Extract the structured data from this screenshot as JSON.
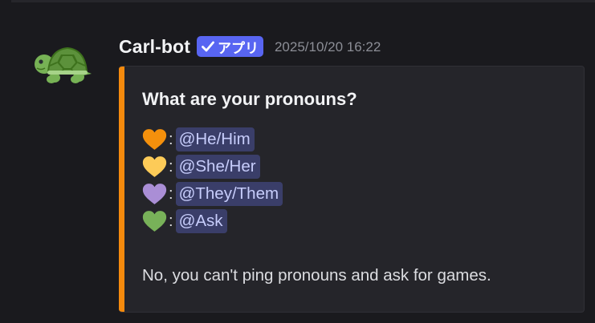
{
  "message": {
    "author": "Carl-bot",
    "app_badge": "アプリ",
    "timestamp": "2025/10/20 16:22",
    "avatar_icon": "turtle-icon"
  },
  "embed": {
    "accent_color": "#f58a0d",
    "title": "What are your pronouns?",
    "roles": [
      {
        "heart_icon": "orange-heart-icon",
        "heart_color": "#f4900c",
        "separator": ":",
        "mention": "@He/Him"
      },
      {
        "heart_icon": "yellow-heart-icon",
        "heart_color": "#fdcb58",
        "separator": ":",
        "mention": "@She/Her"
      },
      {
        "heart_icon": "purple-heart-icon",
        "heart_color": "#aa8ed6",
        "separator": ":",
        "mention": "@They/Them"
      },
      {
        "heart_icon": "green-heart-icon",
        "heart_color": "#78b159",
        "separator": ":",
        "mention": "@Ask"
      }
    ],
    "description": "No, you can't ping pronouns and ask for games."
  },
  "colors": {
    "background": "#1a1a1e",
    "embed_background": "#25252a",
    "badge": "#5865f2",
    "mention_background": "#3a3e69",
    "mention_text": "#c7cdfb"
  }
}
